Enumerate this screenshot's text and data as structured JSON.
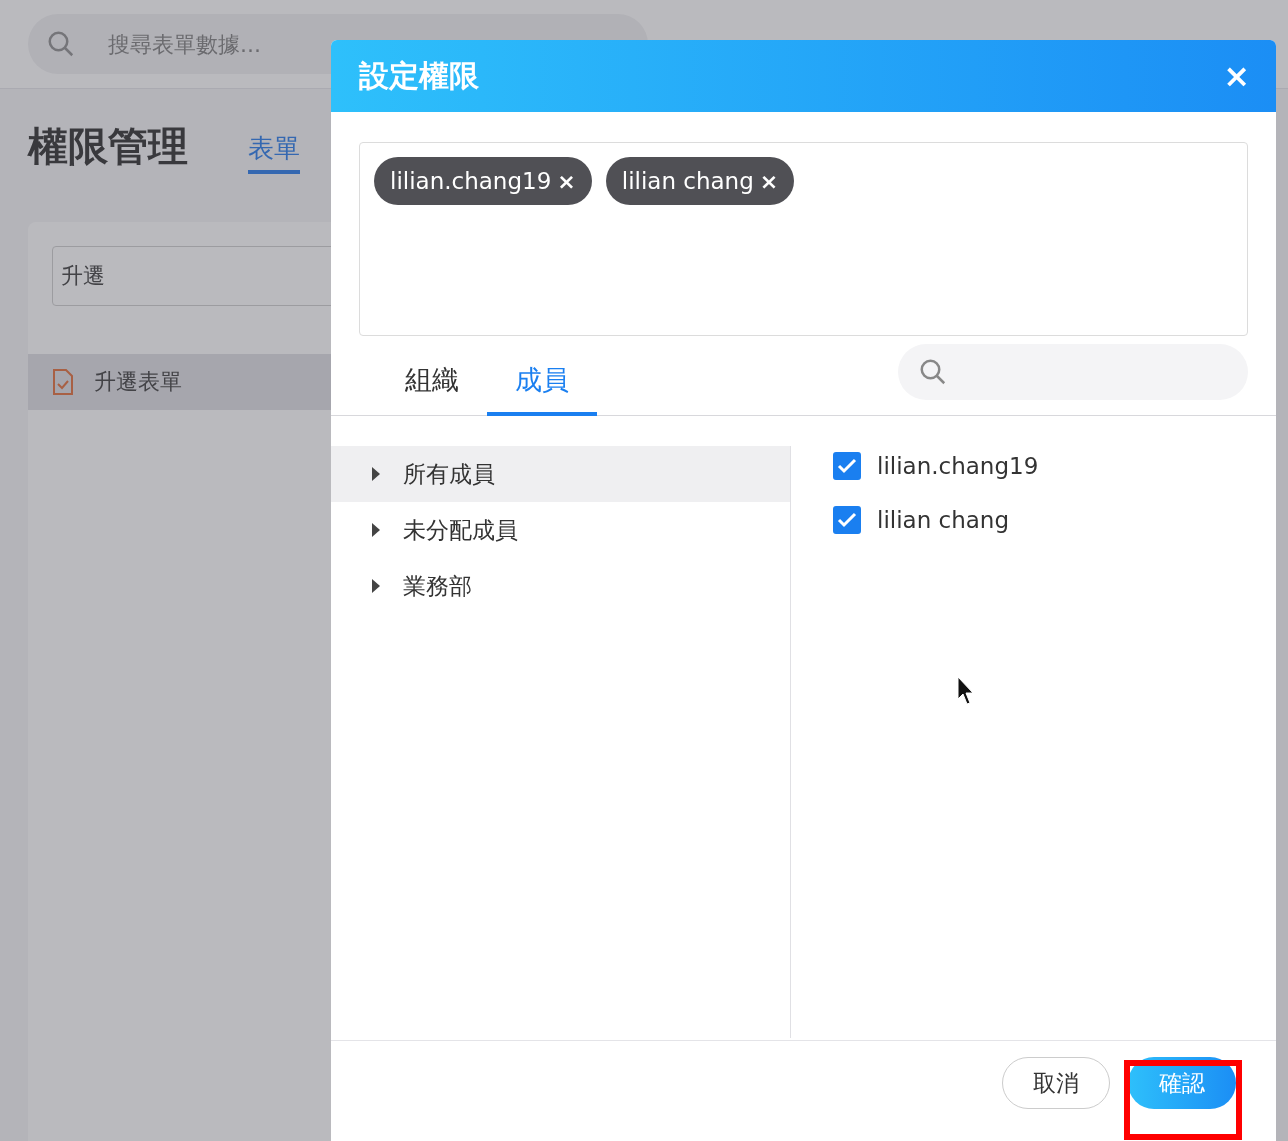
{
  "background": {
    "search": {
      "placeholder": "搜尋表單數據..."
    },
    "title": "權限管理",
    "tab": {
      "label": "表單",
      "selected": true
    },
    "filter": {
      "value": "升遷"
    },
    "forms": [
      {
        "label": "升遷表單",
        "selected": true
      }
    ]
  },
  "dialog": {
    "title": "設定權限",
    "close": "×",
    "tags": [
      {
        "label": "lilian.chang19"
      },
      {
        "label": "lilian chang"
      }
    ],
    "tabs": [
      {
        "label": "組織",
        "selected": false
      },
      {
        "label": "成員",
        "selected": true
      }
    ],
    "tree": [
      {
        "label": "所有成員",
        "selected": true,
        "expanded": false
      },
      {
        "label": "未分配成員",
        "selected": false,
        "expanded": false
      },
      {
        "label": "業務部",
        "selected": false,
        "expanded": false
      }
    ],
    "members": [
      {
        "name": "lilian.chang19",
        "checked": true
      },
      {
        "name": "lilian chang",
        "checked": true
      }
    ],
    "buttons": [
      {
        "label": "取消",
        "kind": "secondary"
      },
      {
        "label": "確認",
        "kind": "primary"
      }
    ]
  }
}
